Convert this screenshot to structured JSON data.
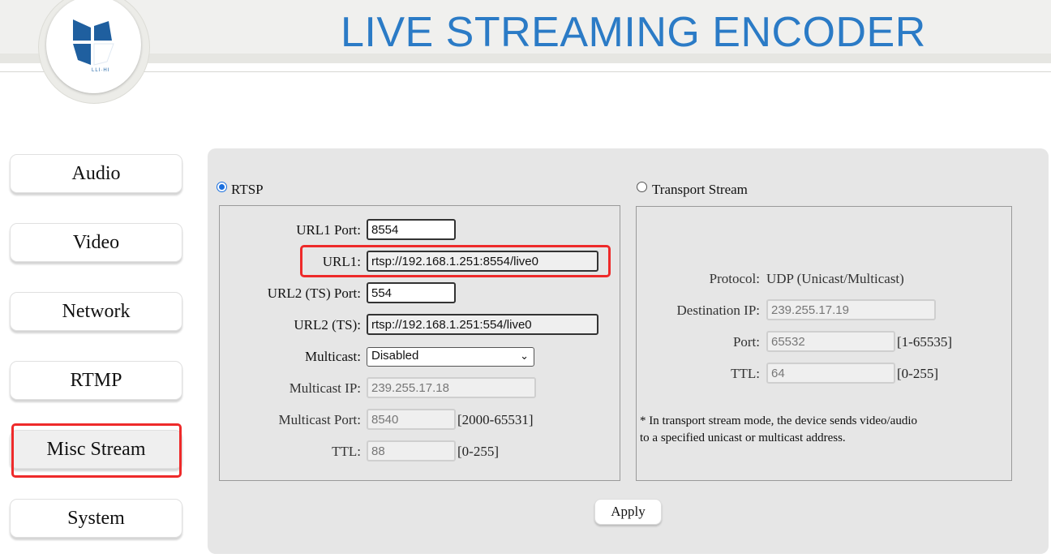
{
  "header": {
    "title": "LIVE STREAMING ENCODER",
    "logo_text": "LLI·HI"
  },
  "sidebar": {
    "items": [
      {
        "label": "Audio"
      },
      {
        "label": "Video"
      },
      {
        "label": "Network"
      },
      {
        "label": "RTMP"
      },
      {
        "label": "Misc Stream",
        "active": true
      },
      {
        "label": "System"
      }
    ]
  },
  "rtsp": {
    "radio_label": "RTSP",
    "selected": true,
    "url1_port_label": "URL1 Port:",
    "url1_port": "8554",
    "url1_label": "URL1:",
    "url1": "rtsp://192.168.1.251:8554/live0",
    "url2_port_label": "URL2 (TS) Port:",
    "url2_port": "554",
    "url2_label": "URL2 (TS):",
    "url2": "rtsp://192.168.1.251:554/live0",
    "multicast_label": "Multicast:",
    "multicast": "Disabled",
    "multicast_ip_label": "Multicast IP:",
    "multicast_ip": "239.255.17.18",
    "multicast_port_label": "Multicast Port:",
    "multicast_port": "8540",
    "multicast_port_range": "[2000-65531]",
    "ttl_label": "TTL:",
    "ttl": "88",
    "ttl_range": "[0-255]"
  },
  "ts": {
    "radio_label": "Transport Stream",
    "selected": false,
    "protocol_label": "Protocol:",
    "protocol": "UDP (Unicast/Multicast)",
    "dest_ip_label": "Destination IP:",
    "dest_ip": "239.255.17.19",
    "port_label": "Port:",
    "port": "65532",
    "port_range": "[1-65535]",
    "ttl_label": "TTL:",
    "ttl": "64",
    "ttl_range": "[0-255]",
    "note_line1": "* In transport stream mode, the device sends video/audio",
    "note_line2": "to a specified unicast or multicast address."
  },
  "apply_label": "Apply",
  "colors": {
    "title": "#2b7bc6",
    "highlight": "#ee2a2a",
    "radio": "#1a6fde"
  }
}
